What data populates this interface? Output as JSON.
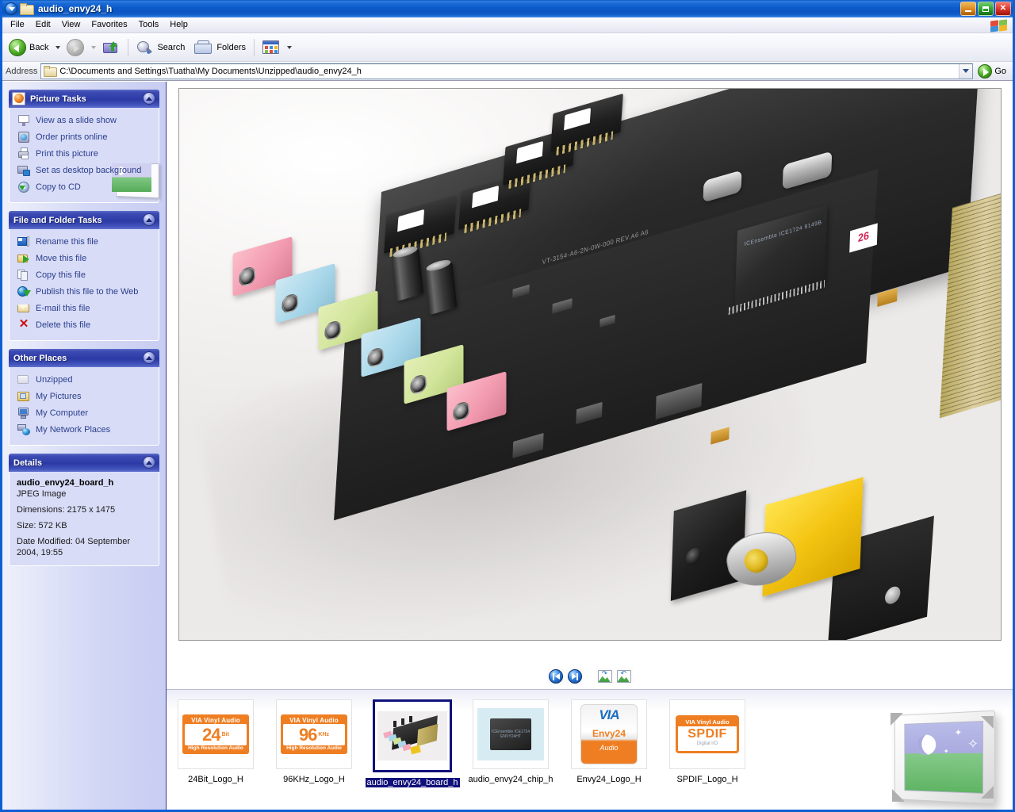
{
  "window": {
    "title": "audio_envy24_h",
    "title_icon": "folder-icon",
    "buttons": {
      "minimize": "minimize",
      "restore": "restore",
      "close": "close"
    }
  },
  "menu": {
    "items": [
      "File",
      "Edit",
      "View",
      "Favorites",
      "Tools",
      "Help"
    ]
  },
  "toolbar": {
    "back_label": "Back",
    "forward_label": "",
    "up_label": "",
    "search_label": "Search",
    "folders_label": "Folders",
    "views_label": ""
  },
  "address": {
    "label": "Address",
    "value": "C:\\Documents and Settings\\Tuatha\\My Documents\\Unzipped\\audio_envy24_h",
    "go_label": "Go"
  },
  "sidebar": {
    "panels": [
      {
        "title": "Picture Tasks",
        "tasks": [
          {
            "label": "View as a slide show",
            "icon": "slideshow-icon"
          },
          {
            "label": "Order prints online",
            "icon": "order-prints-icon"
          },
          {
            "label": "Print this picture",
            "icon": "printer-icon"
          },
          {
            "label": "Set as desktop background",
            "icon": "desktop-icon"
          },
          {
            "label": "Copy to CD",
            "icon": "cd-icon"
          }
        ]
      },
      {
        "title": "File and Folder Tasks",
        "tasks": [
          {
            "label": "Rename this file",
            "icon": "rename-icon"
          },
          {
            "label": "Move this file",
            "icon": "move-icon"
          },
          {
            "label": "Copy this file",
            "icon": "copy-icon"
          },
          {
            "label": "Publish this file to the Web",
            "icon": "publish-web-icon"
          },
          {
            "label": "E-mail this file",
            "icon": "email-icon"
          },
          {
            "label": "Delete this file",
            "icon": "delete-icon"
          }
        ]
      },
      {
        "title": "Other Places",
        "tasks": [
          {
            "label": "Unzipped",
            "icon": "folder-icon"
          },
          {
            "label": "My Pictures",
            "icon": "my-pictures-icon"
          },
          {
            "label": "My Computer",
            "icon": "my-computer-icon"
          },
          {
            "label": "My Network Places",
            "icon": "my-network-places-icon"
          }
        ]
      },
      {
        "title": "Details",
        "details": {
          "name": "audio_envy24_board_h",
          "type": "JPEG Image",
          "dimensions": "Dimensions: 2175 x 1475",
          "size": "Size: 572 KB",
          "modified": "Date Modified: 04 September 2004, 19:55"
        }
      }
    ]
  },
  "preview": {
    "image_name": "audio_envy24_board_h",
    "image_description": "Photograph of a VIA Envy24 PCI sound card: black PCB angled across a white background, with pink, blue and green 3.5 mm audio jacks on the left bracket, a yellow RCA coaxial S/PDIF connector, black pin headers along the top edge, electrolytic capacitors, two metal-can crystal oscillators, a large square QFP controller chip, and a gold PCI edge connector on the right.",
    "pcb_silkscreen": "VT-3154-A6-2N-0W-000 REV.A6 A6",
    "chip_silkscreen": "ICEnsemble  ICE1724  8149B",
    "sticker_text": "26",
    "controls": [
      {
        "name": "previous-image",
        "glyph": "prev"
      },
      {
        "name": "next-image",
        "glyph": "next"
      },
      {
        "name": "rotate-clockwise",
        "glyph": "rotate-cw"
      },
      {
        "name": "rotate-counterclockwise",
        "glyph": "rotate-ccw"
      }
    ]
  },
  "filmstrip": {
    "thumbnails": [
      {
        "label": "24Bit_Logo_H",
        "kind": "via-logo",
        "top_text": "VIA Vinyl Audio",
        "big_text": "24",
        "small_text": "Bit",
        "bottom_text": "High Resolution Audio",
        "selected": false
      },
      {
        "label": "96KHz_Logo_H",
        "kind": "via-logo",
        "top_text": "VIA Vinyl Audio",
        "big_text": "96",
        "small_text": "KHz",
        "bottom_text": "High Resolution Audio",
        "selected": false
      },
      {
        "label": "audio_envy24_board_h",
        "kind": "board-photo",
        "selected": true
      },
      {
        "label": "audio_envy24_chip_h",
        "kind": "chip-photo",
        "chip_text": "ICEnsemble ICE1724 ENVY24HT",
        "selected": false
      },
      {
        "label": "Envy24_Logo_H",
        "kind": "envy-logo",
        "brand": "VIA",
        "name": "Envy24",
        "sub": "Audio",
        "selected": false
      },
      {
        "label": "SPDIF_Logo_H",
        "kind": "spdif-logo",
        "top_text": "VIA Vinyl Audio",
        "big_text": "SPDIF",
        "small_text": "Digital I/O",
        "selected": false
      }
    ]
  },
  "colors": {
    "titlebar_blue": "#0b55c0",
    "sidebar_panel_header": "#2b3aa5",
    "sidebar_panel_body": "#d8dcf7",
    "link_blue": "#2b3f8c",
    "selection_navy": "#10107a",
    "via_orange": "#ef7e22"
  }
}
